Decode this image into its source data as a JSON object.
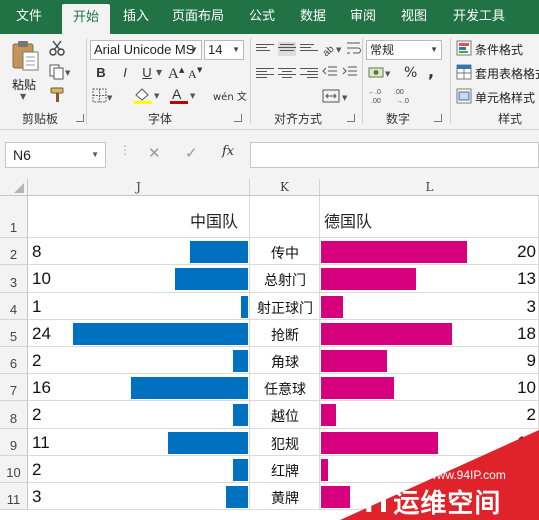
{
  "ribbon": {
    "tabs": [
      {
        "label": "文件",
        "active": false
      },
      {
        "label": "开始",
        "active": true
      },
      {
        "label": "插入",
        "active": false
      },
      {
        "label": "页面布局",
        "active": false
      },
      {
        "label": "公式",
        "active": false
      },
      {
        "label": "数据",
        "active": false
      },
      {
        "label": "审阅",
        "active": false
      },
      {
        "label": "视图",
        "active": false
      },
      {
        "label": "开发工具",
        "active": false
      }
    ],
    "clipboard": {
      "paste_label": "粘贴",
      "group_label": "剪贴板"
    },
    "font": {
      "font_name": "Arial Unicode MS",
      "font_size": "14",
      "bold": "B",
      "italic": "I",
      "underline": "U",
      "group_label": "字体",
      "wen_label": "wén 文",
      "font_color": "#c00000",
      "fill_color": "#ffff00"
    },
    "alignment": {
      "group_label": "对齐方式"
    },
    "number": {
      "format": "常规",
      "percent": "%",
      "comma": ",",
      "group_label": "数字"
    },
    "styles": {
      "conditional": "条件格式",
      "table": "套用表格格式",
      "cell": "单元格样式",
      "group_label": "样式"
    }
  },
  "formula_bar": {
    "name_box": "N6",
    "formula": "",
    "fx": "fx"
  },
  "sheet": {
    "columns": [
      "J",
      "K",
      "L"
    ],
    "rows": [
      "1",
      "2",
      "3",
      "4",
      "5",
      "6",
      "7",
      "8",
      "9",
      "10",
      "11"
    ],
    "left_header": "中国队",
    "right_header": "德国队",
    "left_color": "#0070c0",
    "right_color": "#d6007f",
    "data": [
      {
        "category": "传中",
        "china": 8,
        "germany": 20
      },
      {
        "category": "总射门",
        "china": 10,
        "germany": 13
      },
      {
        "category": "射正球门",
        "china": 1,
        "germany": 3
      },
      {
        "category": "抢断",
        "china": 24,
        "germany": 18
      },
      {
        "category": "角球",
        "china": 2,
        "germany": 9
      },
      {
        "category": "任意球",
        "china": 16,
        "germany": 10
      },
      {
        "category": "越位",
        "china": 2,
        "germany": 2
      },
      {
        "category": "犯规",
        "china": 11,
        "germany": 16
      },
      {
        "category": "红牌",
        "china": 2,
        "germany": 1
      },
      {
        "category": "黄牌",
        "china": 3,
        "germany": 4
      }
    ]
  },
  "watermark": {
    "url": "www.94IP.com",
    "name": "IT运维空间"
  }
}
